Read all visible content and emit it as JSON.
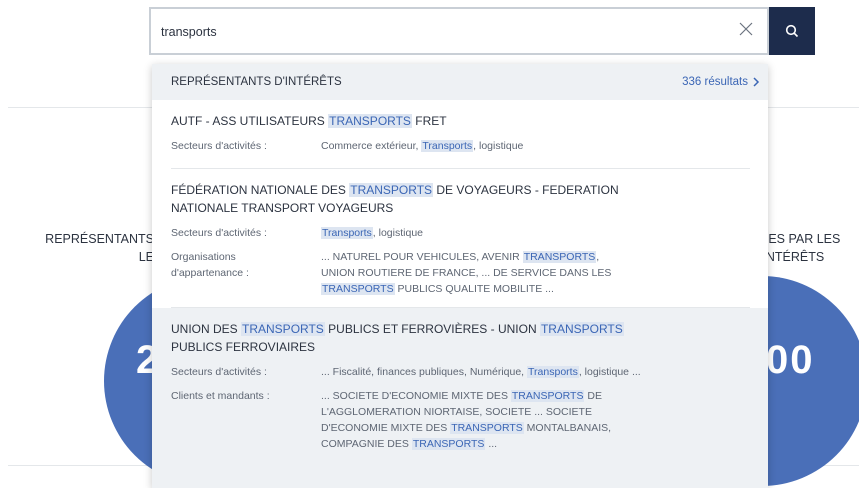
{
  "search": {
    "query": "transports",
    "clear_icon": "close-icon",
    "submit_icon": "search-icon",
    "accent": "#1d2c4c"
  },
  "background": {
    "left_label": [
      "REPRÉSENTANTS",
      "LE"
    ],
    "left_number": "2",
    "right_label": [
      "ÉES PAR LES",
      "'INTÉRÊTS"
    ],
    "right_number": "00",
    "circle_color": "#4a6fb8"
  },
  "dropdown": {
    "category": "REPRÉSENTANTS D'INTÉRÊTS",
    "count": "336 résultats",
    "count_icon": "chevron-right-icon",
    "results": [
      {
        "title": [
          "AUTF - ASS UTILISATEURS ",
          "TRANSPORTS",
          " FRET"
        ],
        "rows": [
          {
            "label": "Secteurs d'activités :",
            "value": [
              "Commerce extérieur, ",
              "Transports",
              ", logistique"
            ]
          }
        ]
      },
      {
        "title": [
          "FÉDÉRATION NATIONALE DES ",
          "TRANSPORTS",
          " DE VOYAGEURS - FEDERATION NATIONALE TRANSPORT VOYAGEURS"
        ],
        "rows": [
          {
            "label": "Secteurs d'activités :",
            "value": [
              "",
              "Transports",
              ", logistique"
            ]
          },
          {
            "label": "Organisations d'appartenance :",
            "value": [
              "... NATUREL POUR VEHICULES, AVENIR ",
              "TRANSPORTS",
              ", UNION ROUTIERE DE FRANCE, ... DE SERVICE DANS LES ",
              "TRANSPORTS",
              " PUBLICS QUALITE MOBILITE ..."
            ]
          }
        ]
      },
      {
        "title": [
          "UNION DES ",
          "TRANSPORTS",
          " PUBLICS ET FERROVIÈRES - UNION ",
          "TRANSPORTS",
          " PUBLICS FERROVIAIRES"
        ],
        "rows": [
          {
            "label": "Secteurs d'activités :",
            "value": [
              "... Fiscalité, finances publiques, Numérique, ",
              "Transports",
              ", logistique ..."
            ]
          },
          {
            "label": "Clients et mandants :",
            "value": [
              "... SOCIETE D'ECONOMIE MIXTE DES ",
              "TRANSPORTS",
              " DE L'AGGLOMERATION NIORTAISE, SOCIETE ... SOCIETE D'ECONOMIE MIXTE DES ",
              "TRANSPORTS",
              " MONTALBANAIS, COMPAGNIE DES ",
              "TRANSPORTS",
              " ..."
            ]
          }
        ]
      }
    ]
  }
}
